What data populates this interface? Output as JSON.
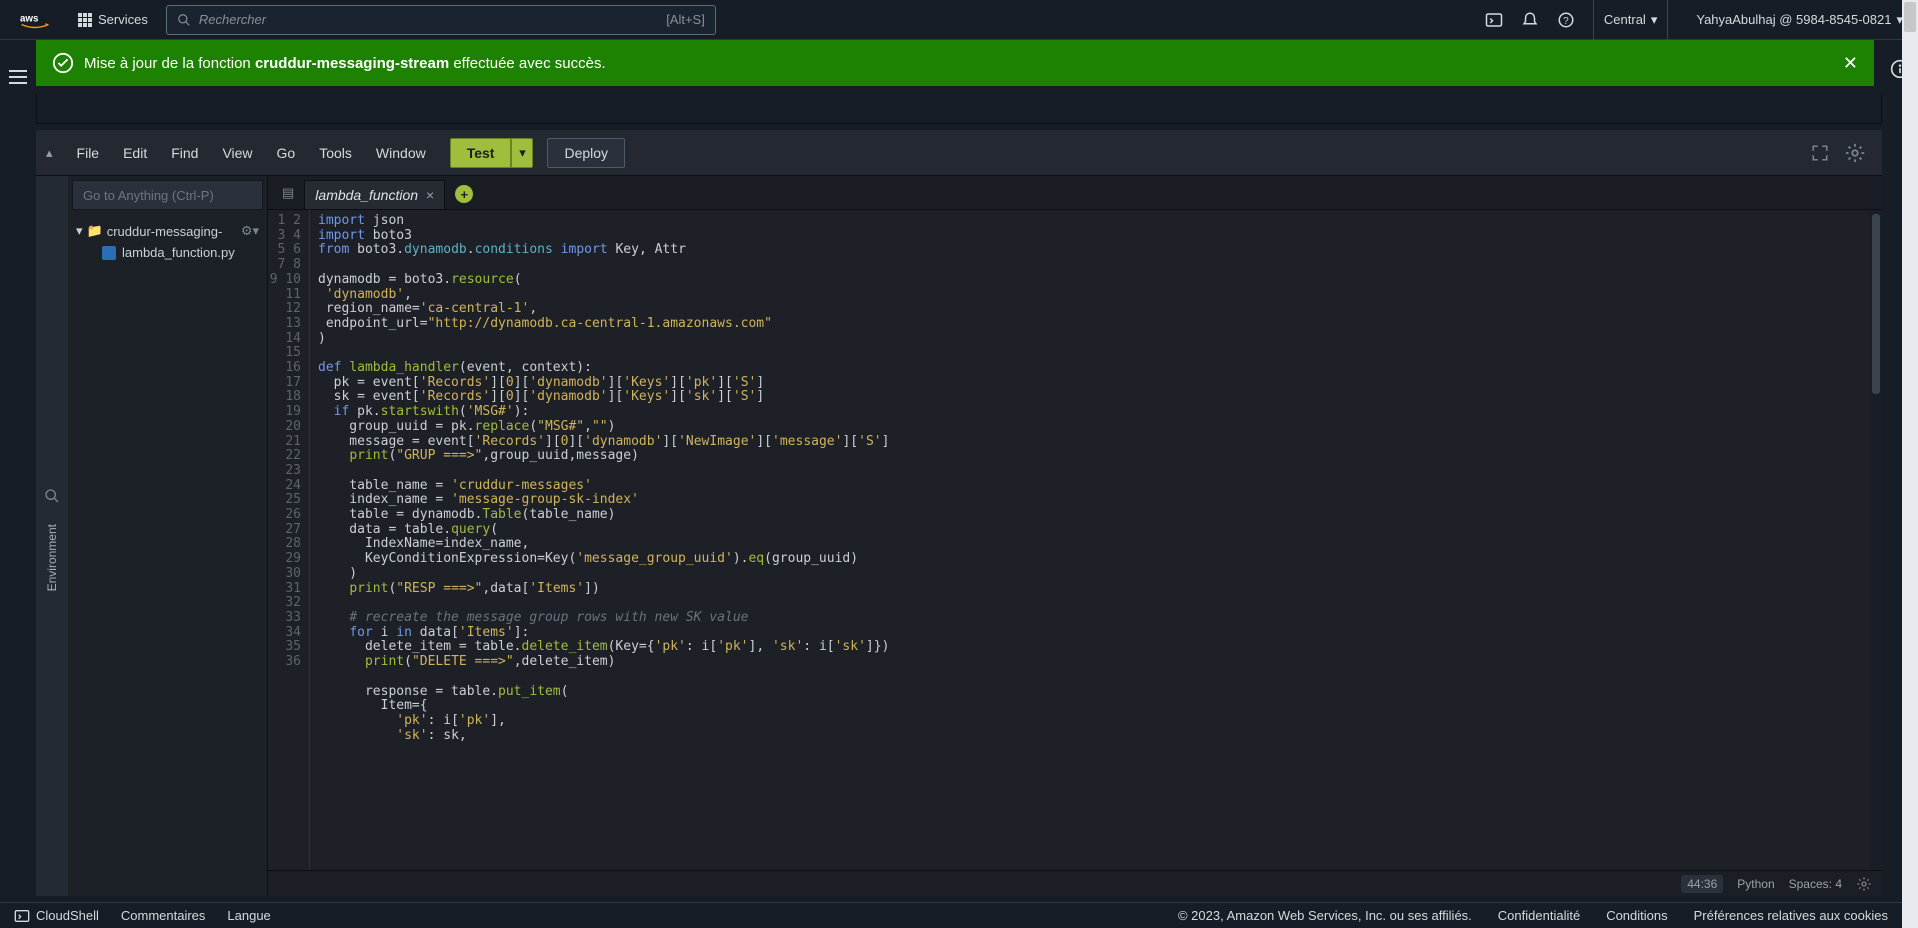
{
  "nav": {
    "services": "Services",
    "search_placeholder": "Rechercher",
    "search_shortcut": "[Alt+S]",
    "region": "Central",
    "user": "YahyaAbulhaj @ 5984-8545-0821"
  },
  "banner": {
    "prefix": "Mise à jour de la fonction ",
    "fn_name": "cruddur-messaging-stream",
    "suffix": " effectuée avec succès."
  },
  "menubar": {
    "file": "File",
    "edit": "Edit",
    "find": "Find",
    "view": "View",
    "go": "Go",
    "tools": "Tools",
    "window": "Window",
    "test": "Test",
    "deploy": "Deploy"
  },
  "goto_placeholder": "Go to Anything (Ctrl-P)",
  "env_label": "Environment",
  "tree": {
    "root": "cruddur-messaging-",
    "file1": "lambda_function.py"
  },
  "tab": {
    "name": "lambda_function"
  },
  "code": {
    "lines": [
      {
        "n": 1,
        "html": "<span class='kw2'>import</span> json"
      },
      {
        "n": 2,
        "html": "<span class='kw2'>import</span> boto3"
      },
      {
        "n": 3,
        "html": "<span class='kw2'>from</span> boto3.<span class='prop'>dynamodb</span>.<span class='prop'>conditions</span> <span class='kw2'>import</span> Key, Attr"
      },
      {
        "n": 4,
        "html": ""
      },
      {
        "n": 5,
        "html": "dynamodb = boto3.<span class='fn'>resource</span>("
      },
      {
        "n": 6,
        "html": " <span class='str'>'dynamodb'</span>,"
      },
      {
        "n": 7,
        "html": " region_name=<span class='str'>'ca-central-1'</span>,"
      },
      {
        "n": 8,
        "html": " endpoint_url=<span class='str'>\"http://dynamodb.ca-central-1.amazonaws.com\"</span>"
      },
      {
        "n": 9,
        "html": ")"
      },
      {
        "n": 10,
        "html": ""
      },
      {
        "n": 11,
        "html": "<span class='kw2'>def</span> <span class='fn'>lambda_handler</span>(event, context):"
      },
      {
        "n": 12,
        "html": "  pk = event[<span class='str'>'Records'</span>][<span class='num'>0</span>][<span class='str'>'dynamodb'</span>][<span class='str'>'Keys'</span>][<span class='str'>'pk'</span>][<span class='str'>'S'</span>]"
      },
      {
        "n": 13,
        "html": "  sk = event[<span class='str'>'Records'</span>][<span class='num'>0</span>][<span class='str'>'dynamodb'</span>][<span class='str'>'Keys'</span>][<span class='str'>'sk'</span>][<span class='str'>'S'</span>]"
      },
      {
        "n": 14,
        "html": "  <span class='kw2'>if</span> pk.<span class='fn'>startswith</span>(<span class='str'>'MSG#'</span>):"
      },
      {
        "n": 15,
        "html": "    group_uuid = pk.<span class='fn'>replace</span>(<span class='str'>\"MSG#\"</span>,<span class='str'>\"\"</span>)"
      },
      {
        "n": 16,
        "html": "    message = event[<span class='str'>'Records'</span>][<span class='num'>0</span>][<span class='str'>'dynamodb'</span>][<span class='str'>'NewImage'</span>][<span class='str'>'message'</span>][<span class='str'>'S'</span>]"
      },
      {
        "n": 17,
        "html": "    <span class='fn'>print</span>(<span class='str'>\"GRUP ===&gt;\"</span>,group_uuid,message)"
      },
      {
        "n": 18,
        "html": ""
      },
      {
        "n": 19,
        "html": "    table_name = <span class='str'>'cruddur-messages'</span>"
      },
      {
        "n": 20,
        "html": "    index_name = <span class='str'>'message-group-sk-index'</span>"
      },
      {
        "n": 21,
        "html": "    table = dynamodb.<span class='fn'>Table</span>(table_name)"
      },
      {
        "n": 22,
        "html": "    data = table.<span class='fn'>query</span>("
      },
      {
        "n": 23,
        "html": "      IndexName=index_name,"
      },
      {
        "n": 24,
        "html": "      KeyConditionExpression=Key(<span class='str'>'message_group_uuid'</span>).<span class='fn'>eq</span>(group_uuid)"
      },
      {
        "n": 25,
        "html": "    )"
      },
      {
        "n": 26,
        "html": "    <span class='fn'>print</span>(<span class='str'>\"RESP ===&gt;\"</span>,data[<span class='str'>'Items'</span>])"
      },
      {
        "n": 27,
        "html": ""
      },
      {
        "n": 28,
        "html": "    <span class='cmt'># recreate the message group rows with new SK value</span>"
      },
      {
        "n": 29,
        "html": "    <span class='kw2'>for</span> i <span class='kw2'>in</span> data[<span class='str'>'Items'</span>]:"
      },
      {
        "n": 30,
        "html": "      delete_item = table.<span class='fn'>delete_item</span>(Key={<span class='str'>'pk'</span>: i[<span class='str'>'pk'</span>], <span class='str'>'sk'</span>: i[<span class='str'>'sk'</span>]})"
      },
      {
        "n": 31,
        "html": "      <span class='fn'>print</span>(<span class='str'>\"DELETE ===&gt;\"</span>,delete_item)"
      },
      {
        "n": 32,
        "html": ""
      },
      {
        "n": 33,
        "html": "      response = table.<span class='fn'>put_item</span>("
      },
      {
        "n": 34,
        "html": "        Item={"
      },
      {
        "n": 35,
        "html": "          <span class='str'>'pk'</span>: i[<span class='str'>'pk'</span>],"
      },
      {
        "n": 36,
        "html": "          <span class='str'>'sk'</span>: sk,"
      }
    ]
  },
  "status": {
    "cursor": "44:36",
    "lang": "Python",
    "spaces": "Spaces: 4"
  },
  "footer": {
    "cloudshell": "CloudShell",
    "comments": "Commentaires",
    "lang": "Langue",
    "copyright": "© 2023, Amazon Web Services, Inc. ou ses affiliés.",
    "privacy": "Confidentialité",
    "terms": "Conditions",
    "cookies": "Préférences relatives aux cookies"
  }
}
